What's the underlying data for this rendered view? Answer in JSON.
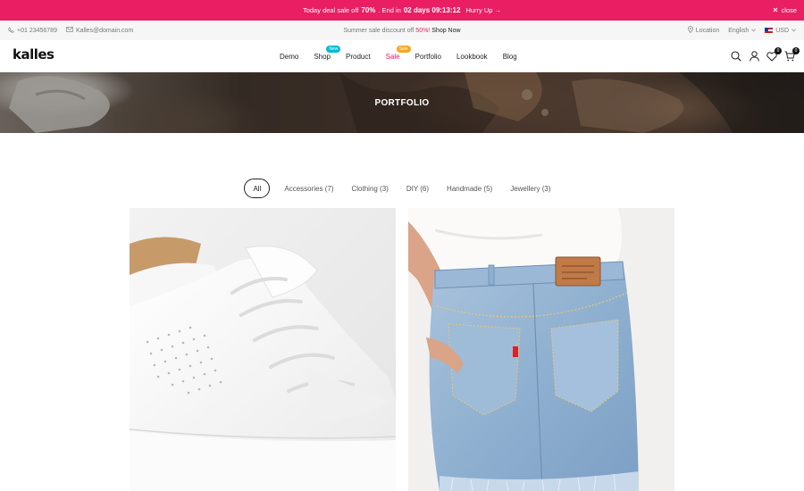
{
  "promo": {
    "text_before": "Today deal sale off",
    "percent": "70%",
    "text_mid": ". End in",
    "countdown": "02 days 09:13:12",
    "hurry": "Hurry Up →",
    "close": "close"
  },
  "topbar": {
    "phone": "+01 23456789",
    "email": "Kalles@domain.com",
    "announcement_before": "Summer sale discount off",
    "announcement_percent": "50%!",
    "announcement_link": "Shop Now",
    "location": "Location",
    "language": "English",
    "currency": "USD"
  },
  "header": {
    "logo": "kalles",
    "nav": [
      {
        "label": "Demo"
      },
      {
        "label": "Shop",
        "badge": "New",
        "badge_color": "#01bad4"
      },
      {
        "label": "Product"
      },
      {
        "label": "Sale",
        "badge": "Sale",
        "badge_color": "#f6a623"
      },
      {
        "label": "Portfolio"
      },
      {
        "label": "Lookbook"
      },
      {
        "label": "Blog"
      }
    ],
    "wishlist_count": "0",
    "cart_count": "0"
  },
  "banner": {
    "title": "PORTFOLIO"
  },
  "filters": [
    {
      "label": "All",
      "active": true
    },
    {
      "label": "Accessories (7)"
    },
    {
      "label": "Clothing (3)"
    },
    {
      "label": "DIY (6)"
    },
    {
      "label": "Handmade (5)"
    },
    {
      "label": "Jewellery (3)"
    }
  ],
  "colors": {
    "accent": "#e91e63",
    "new_badge": "#01bad4",
    "sale_badge": "#f6a623"
  }
}
